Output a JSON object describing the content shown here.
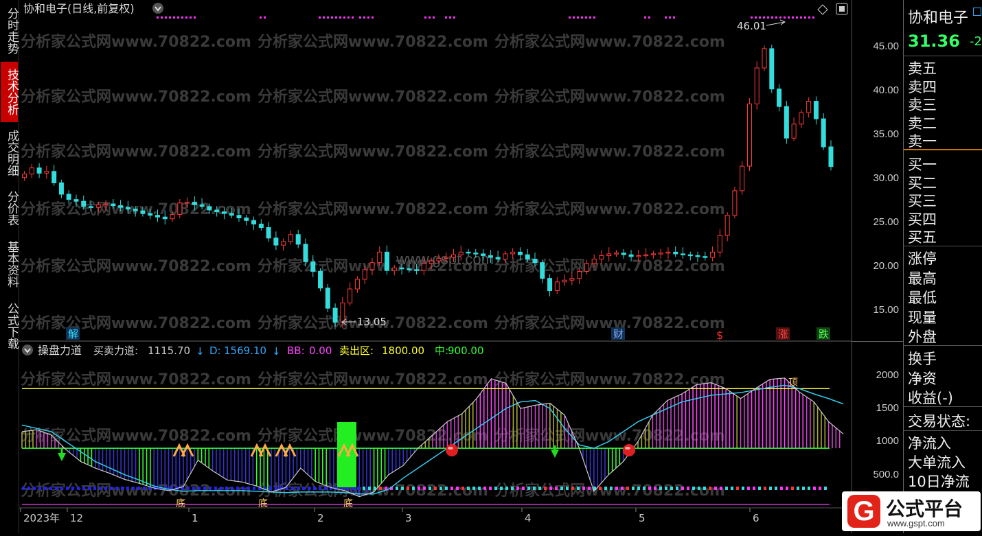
{
  "left_tabs": [
    "分时走势",
    "技术分析",
    "成交明细",
    "分价表",
    "基本资料",
    "公式下载"
  ],
  "active_tab_index": 1,
  "main_chart": {
    "title": "协和电子(日线,前复权)",
    "high_label": "46.01",
    "low_label": "13.05",
    "watermark": "分析家公式网www.70822.com",
    "center_watermark": "www.gspt.com",
    "markers": {
      "jie": "解",
      "cai": "财",
      "dollar": "$",
      "zhang": "涨",
      "die": "跌"
    },
    "y_ticks": [
      "45.00",
      "40.00",
      "35.00",
      "30.00",
      "25.00",
      "20.00",
      "15.00"
    ]
  },
  "indicator": {
    "name": "操盘力道",
    "mm_label": "买卖力道:",
    "mm_value": "1115.70",
    "d_label": "D:",
    "d_value": "1569.10",
    "bb_label": "BB:",
    "bb_value": "0.00",
    "sell_label": "卖出区:",
    "sell_value": "1800.00",
    "mid_label": "中:",
    "mid_value": "900.00",
    "y_ticks": [
      "2000",
      "1500",
      "1000",
      "500.0"
    ],
    "bottom_label": "底",
    "top_label": "顶",
    "colors": {
      "mm": "#cccccc",
      "d": "#33aaff",
      "bb": "#ff44ff",
      "sell": "#ffff00",
      "mid": "#33ff33"
    }
  },
  "x_axis": [
    "2023年",
    "12",
    "1",
    "2",
    "3",
    "4",
    "5",
    "6"
  ],
  "chart_data": [
    {
      "type": "candlestick",
      "title": "协和电子(日线,前复权)",
      "ylim": [
        12,
        48
      ],
      "y_ticks": [
        15,
        20,
        25,
        30,
        35,
        40,
        45
      ],
      "annotations": [
        {
          "text": "46.01",
          "value": 46.01
        },
        {
          "text": "13.05",
          "value": 13.05
        }
      ],
      "series": [
        {
          "name": "close",
          "values": [
            30.5,
            31.2,
            30.6,
            30.8,
            29.5,
            28.2,
            27.6,
            27.4,
            26.8,
            26.7,
            27.0,
            27.1,
            26.9,
            26.7,
            26.5,
            26.3,
            26.0,
            25.8,
            25.6,
            25.4,
            25.9,
            27.2,
            27.3,
            27.0,
            26.8,
            26.4,
            26.2,
            26.0,
            25.8,
            25.5,
            25.2,
            24.8,
            24.4,
            23.2,
            22.4,
            22.8,
            23.6,
            22.5,
            20.5,
            19.4,
            17.5,
            15.2,
            13.6,
            15.8,
            17.4,
            18.5,
            19.6,
            20.4,
            21.6,
            19.5,
            19.8,
            19.7,
            19.6,
            19.5,
            20.3,
            20.6,
            20.9,
            21.0,
            21.3,
            21.6,
            21.5,
            21.4,
            21.2,
            21.0,
            20.8,
            21.4,
            21.6,
            21.3,
            20.8,
            20.4,
            18.6,
            17.2,
            18.2,
            18.4,
            18.6,
            19.4,
            20.3,
            20.8,
            21.2,
            21.4,
            21.5,
            21.3,
            21.1,
            21.2,
            21.3,
            21.4,
            21.5,
            21.6,
            21.4,
            21.3,
            21.2,
            21.1,
            21.0,
            21.6,
            23.5,
            25.8,
            28.6,
            31.4,
            38.5,
            42.6,
            44.8,
            40.2,
            38.2,
            34.6,
            36.2,
            37.5,
            38.8,
            36.8,
            33.6,
            31.36
          ]
        }
      ]
    },
    {
      "type": "line",
      "title": "操盘力道",
      "ylim": [
        0,
        2300
      ],
      "y_ticks": [
        500,
        1000,
        1500,
        2000
      ],
      "series": [
        {
          "name": "买卖力道",
          "values": [
            1150,
            1180,
            1100,
            880,
            700,
            600,
            520,
            430,
            370,
            300,
            260,
            320,
            720,
            560,
            420,
            390,
            330,
            240,
            310,
            600,
            400,
            310,
            260,
            170,
            240,
            500,
            640,
            900,
            1100,
            1300,
            1420,
            1650,
            1950,
            1880,
            1500,
            1550,
            1580,
            1400,
            900,
            250,
            500,
            700,
            1000,
            1400,
            1620,
            1720,
            1860,
            1890,
            1800,
            1650,
            1800,
            1940,
            1960,
            1750,
            1600,
            1300,
            1115.7
          ]
        },
        {
          "name": "D",
          "values": [
            1250,
            1200,
            1150,
            1000,
            850,
            700,
            600,
            500,
            420,
            330,
            280,
            250,
            260,
            260,
            260,
            260,
            250,
            240,
            230,
            240,
            240,
            240,
            230,
            210,
            210,
            280,
            450,
            600,
            750,
            900,
            1050,
            1200,
            1350,
            1500,
            1600,
            1620,
            1500,
            1200,
            950,
            900,
            1000,
            1150,
            1300,
            1400,
            1500,
            1600,
            1650,
            1700,
            1720,
            1740,
            1780,
            1820,
            1850,
            1800,
            1720,
            1650,
            1569.1
          ]
        },
        {
          "name": "卖出区",
          "values": [
            1800
          ]
        },
        {
          "name": "中",
          "values": [
            900
          ]
        }
      ]
    }
  ],
  "quote_panel": {
    "stock_name": "协和电子",
    "price": "31.36",
    "change_prefix": "-2",
    "order_book_sell": [
      "卖五",
      "卖四",
      "卖三",
      "卖二",
      "卖一"
    ],
    "order_book_buy": [
      "买一",
      "买二",
      "买三",
      "买四",
      "买五"
    ],
    "stats": [
      "涨停",
      "最高",
      "最低",
      "现量",
      "外盘"
    ],
    "stats2": [
      "换手",
      "净资",
      "收益(-)"
    ],
    "trade_status": "交易状态:",
    "flows": [
      "净流入",
      "大单流入",
      "10日净流"
    ]
  },
  "logo": {
    "glyph": "G",
    "text": "公式平台",
    "url": "www.gspt.com"
  }
}
